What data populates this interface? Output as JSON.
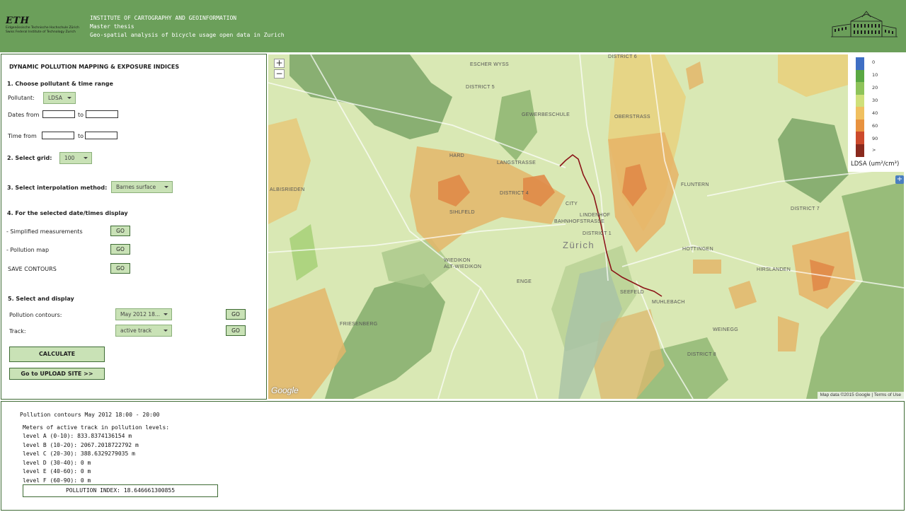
{
  "header": {
    "org_mark": "ETH",
    "org_line1": "Eidgenössische Technische Hochschule Zürich",
    "org_line2": "Swiss Federal Institute of Technology Zurich",
    "institute": "INSTITUTE OF CARTOGRAPHY AND GEOINFORMATION",
    "thesis": "Master thesis",
    "subtitle": "Geo-spatial analysis of bicycle usage open data in Zurich"
  },
  "panel": {
    "title": "DYNAMIC POLLUTION MAPPING & EXPOSURE INDICES",
    "step1": "1. Choose pollutant & time range",
    "pollutant_label": "Pollutant:",
    "pollutant_value": "LDSA",
    "dates_from": "Dates from",
    "to": "to",
    "time_from": "Time from",
    "step2": "2. Select grid:",
    "grid_value": "100",
    "step3": "3. Select interpolation method:",
    "interp_value": "Barnes surface",
    "step4": "4. For the selected date/times display",
    "simplified": "- Simplified measurements",
    "pollution_map": "- Pollution map",
    "save_contours": "SAVE CONTOURS",
    "go": "GO",
    "step5": "5. Select and display",
    "contours_label": "Pollution contours:",
    "contours_value": "May 2012 18...",
    "track_label": "Track:",
    "track_value": "active track",
    "calculate": "CALCULATE",
    "upload": "Go to UPLOAD SITE >>"
  },
  "map": {
    "zoom_in": "+",
    "zoom_out": "−",
    "plus": "+",
    "google": "Google",
    "attribution": "Map data ©2015 Google  |  Terms of Use",
    "labels": {
      "escher_wyss": "ESCHER WYSS",
      "district5": "DISTRICT 5",
      "gewerbeschule": "GEWERBESCHULE",
      "oberstrass": "OBERSTRASS",
      "langstrasse": "LANGSTRASSE",
      "district4": "DISTRICT 4",
      "sihlfeld": "SIHLFELD",
      "city": "CITY",
      "lindenhof": "LINDENHOF",
      "bahnhofstrasse": "BAHNHOFSTRASSE",
      "district1": "DISTRICT 1",
      "zurich": "Zürich",
      "fluntern": "FLUNTERN",
      "district7": "DISTRICT 7",
      "hottingen": "HOTTINGEN",
      "hirslanden": "HIRSLANDEN",
      "wiedikon": "WIEDIKON",
      "alt_wiedikon": "ALT-WIEDIKON",
      "enge": "ENGE",
      "seefeld": "SEEFELD",
      "muhlebach": "MUHLEBACH",
      "weinegg": "WEINEGG",
      "district8": "DISTRICT 8",
      "friesenberg": "FRIESENBERG",
      "albisrieden": "ALBISRIEDEN",
      "hard": "HARD",
      "district6": "DISTRICT 6"
    }
  },
  "legend": {
    "title": "LDSA (um²/cm³)",
    "items": [
      {
        "label": "0",
        "color": "#3f6fc4"
      },
      {
        "label": "10",
        "color": "#5aa843"
      },
      {
        "label": "20",
        "color": "#8ec35a"
      },
      {
        "label": "30",
        "color": "#cfe07a"
      },
      {
        "label": "40",
        "color": "#f0c060"
      },
      {
        "label": "60",
        "color": "#e8923f"
      },
      {
        "label": "90",
        "color": "#cc4a2c"
      },
      {
        "label": ">",
        "color": "#8a2a1e"
      }
    ]
  },
  "results": {
    "title": "Pollution contours May 2012 18:00 - 20:00",
    "meters_heading": "Meters of active track in pollution levels:",
    "levels": [
      "level A (0-10): 833.8374136154 m",
      "level B (10-20): 2067.2018722792 m",
      "level C (20-30): 388.6329279035 m",
      "level D (30-40): 0 m",
      "level E (40-60): 0 m",
      "level F (60-90): 0 m"
    ],
    "pollution_index": "POLLUTION INDEX: 18.646661300855"
  }
}
